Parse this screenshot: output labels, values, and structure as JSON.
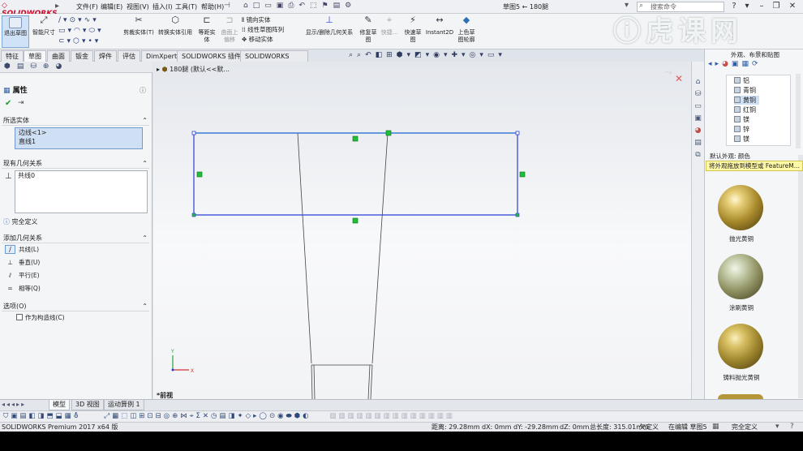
{
  "app": {
    "logo_text": "SOLIDWORKS",
    "menus": [
      "文件(F)",
      "编辑(E)",
      "视图(V)",
      "插入(I)",
      "工具(T)",
      "帮助(H)"
    ],
    "document_title": "草图5 ← 180腿",
    "search_placeholder": "搜索命令",
    "watermark": "虎课网"
  },
  "command_manager": {
    "exit_sketch": "退出草图",
    "smart_dimension": "智能尺寸",
    "trim_entities": "剪裁实体(T)",
    "convert_entities": "转换实体引用",
    "offset_entities": "等距实体",
    "offset_surface": "曲面上偏移",
    "mirror_entities": "镜向实体",
    "linear_pattern": "线性草图阵列",
    "move_entities": "移动实体",
    "display_delete_relations": "显示/删除几何关系",
    "repair_sketch": "修复草图",
    "quick_snaps": "快捷...",
    "rapid_sketch": "快速草图",
    "instant2d": "Instant2D",
    "shaded_contours": "上色草图轮廓"
  },
  "tabs": [
    "特征",
    "草图",
    "曲面",
    "钣金",
    "焊件",
    "评估",
    "DimXpert",
    "SOLIDWORKS 插件",
    "SOLIDWORKS MBD"
  ],
  "active_tab": "草图",
  "property_manager": {
    "title": "属性",
    "selected_entities_label": "所选实体",
    "selected_entities": [
      "边线<1>",
      "直线1"
    ],
    "existing_relations_label": "现有几何关系",
    "existing_relations": [
      "共线0"
    ],
    "status": "完全定义",
    "add_relations_label": "添加几何关系",
    "add_relations": [
      "共线(L)",
      "垂直(U)",
      "平行(E)",
      "相等(Q)"
    ],
    "options_label": "选项(O)",
    "construction_label": "作为构造线(C)"
  },
  "tree": {
    "part_name": "180腿 (默认<<默..."
  },
  "view": {
    "orientation": "*前视"
  },
  "appearance_pane": {
    "title": "外观、布景和贴图",
    "materials": [
      "铝",
      "青铜",
      "黄铜",
      "红铜",
      "镁",
      "锌",
      "镁"
    ],
    "selected_material": "黄铜",
    "default_label": "默认外观: 颜色",
    "tooltip": "将外观拖放到模型或 FeatureM...",
    "swatches": [
      "抛光黄铜",
      "涂刷黄铜",
      "铸料抛光黄铜"
    ]
  },
  "view_tabs": [
    "模型",
    "3D 视图",
    "运动算例 1"
  ],
  "status_bar": {
    "product": "SOLIDWORKS Premium 2017 x64 版",
    "distance": "距离: 29.28mm",
    "dx": "dX: 0mm",
    "dy": "dY: -29.28mm",
    "dz": "dZ: 0mm",
    "total_length": "总长度: 315.01mm",
    "defined_state": "欠定义",
    "editing": "在编辑 草图5",
    "fully_defined": "完全定义"
  },
  "colors": {
    "sketch_blue": "#2b3dd8",
    "selected_line": "#3a7bd5",
    "relation_green": "#1fbf3a",
    "brass": "#b99a3a"
  }
}
